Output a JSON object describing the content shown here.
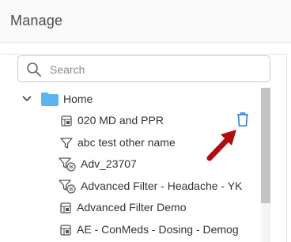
{
  "header": {
    "title": "Manage"
  },
  "search": {
    "placeholder": "Search"
  },
  "tree": {
    "root": {
      "label": "Home"
    },
    "items": [
      {
        "label": "020 MD and PPR",
        "icon": "report-icon"
      },
      {
        "label": "abc test other name",
        "icon": "filter-icon"
      },
      {
        "label": "Adv_23707",
        "icon": "filter-link-icon"
      },
      {
        "label": "Advanced Filter - Headache - YK",
        "icon": "filter-link-icon"
      },
      {
        "label": "Advanced Filter Demo",
        "icon": "report-icon"
      },
      {
        "label": "AE - ConMeds - Dosing - Demog",
        "icon": "report-icon"
      }
    ]
  },
  "colors": {
    "folder": "#5bb4f0",
    "trash": "#2f7fd6",
    "arrow": "#b00d12",
    "scroll_thumb": "#c4c4c4"
  }
}
